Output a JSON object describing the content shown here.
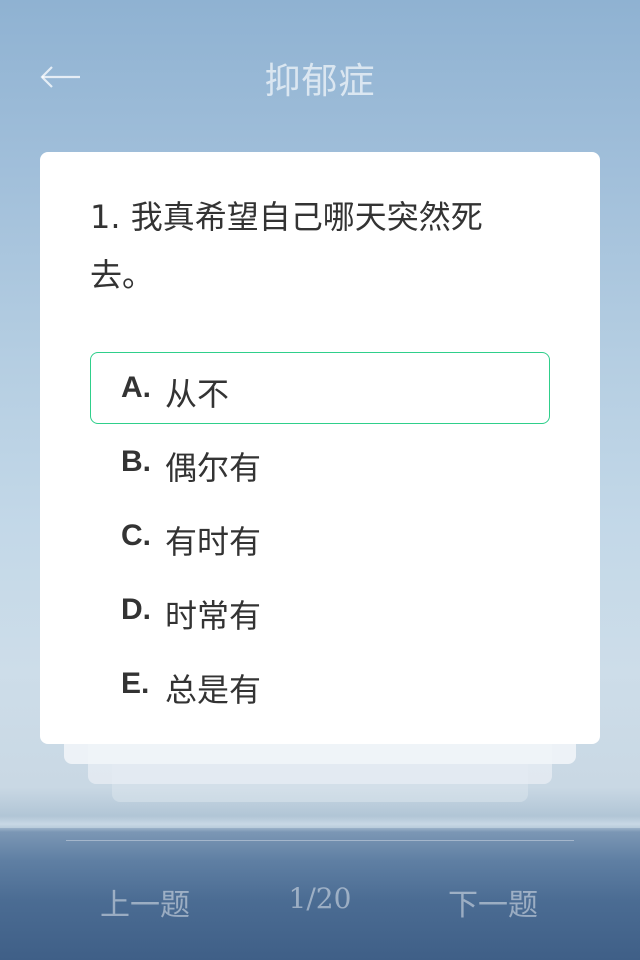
{
  "header": {
    "title": "抑郁症",
    "back_icon": "arrow-left-icon"
  },
  "question": {
    "text": "1. 我真希望自己哪天突然死去。"
  },
  "options": [
    {
      "letter": "A.",
      "label": "从不",
      "selected": true
    },
    {
      "letter": "B.",
      "label": "偶尔有",
      "selected": false
    },
    {
      "letter": "C.",
      "label": "有时有",
      "selected": false
    },
    {
      "letter": "D.",
      "label": "时常有",
      "selected": false
    },
    {
      "letter": "E.",
      "label": "总是有",
      "selected": false
    }
  ],
  "footer": {
    "prev_label": "上一题",
    "progress": "1/20",
    "next_label": "下一题"
  },
  "colors": {
    "selected_border": "#2fcf8b",
    "text": "#333333"
  }
}
